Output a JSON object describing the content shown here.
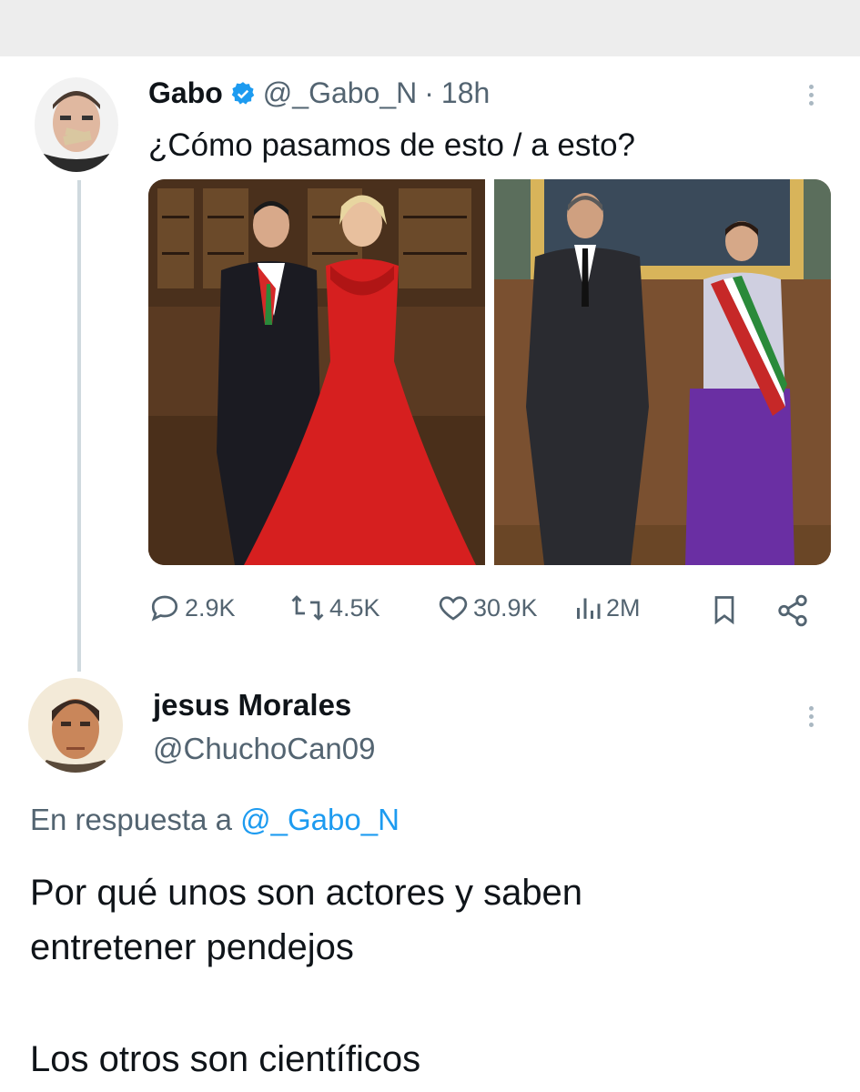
{
  "tweet": {
    "author_name": "Gabo",
    "handle": "@_Gabo_N",
    "separator": "·",
    "time": "18h",
    "text": "¿Cómo pasamos de esto / a esto?",
    "stats": {
      "replies": "2.9K",
      "retweets": "4.5K",
      "likes": "30.9K",
      "views": "2M"
    }
  },
  "reply": {
    "author_name": "jesus Morales",
    "handle": "@ChuchoCan09",
    "reply_prefix": "En respuesta a",
    "reply_to": "@_Gabo_N",
    "text_line1": "Por qué unos son actores y saben",
    "text_line2": "entretener pendejos",
    "text_line3": "Los otros son científicos"
  },
  "colors": {
    "verified": "#1d9bf0",
    "link": "#1d9bf0",
    "muted": "#536471",
    "red_dress": "#d61f1f",
    "purple_dress": "#6a2fa3"
  },
  "icons": [
    "reply-icon",
    "retweet-icon",
    "like-icon",
    "views-icon",
    "bookmark-icon",
    "share-icon",
    "verified-icon",
    "more-icon"
  ]
}
